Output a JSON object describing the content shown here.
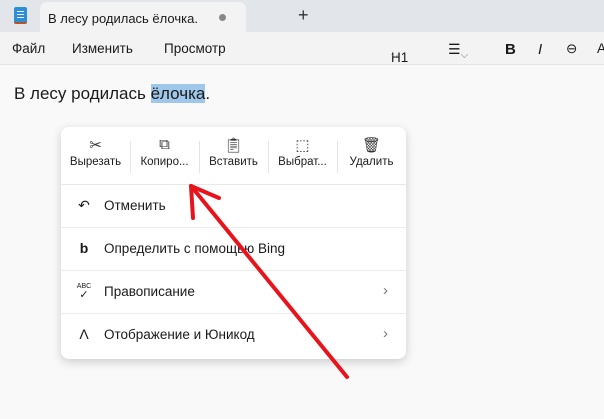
{
  "window": {
    "tab_title": "В лесу родилась ёлочка.",
    "new_tab": "+"
  },
  "menu": [
    "Файл",
    "Изменить",
    "Просмотр"
  ],
  "toolbar": {
    "heading": "H1",
    "bold": "B",
    "italic": "I"
  },
  "editor": {
    "text_before": "В лесу родилась ",
    "selected": "ёлочка",
    "text_after": "."
  },
  "context_menu": {
    "tools": [
      {
        "icon": "scissors-icon",
        "label": "Вырезать"
      },
      {
        "icon": "copy-icon",
        "label": "Копиро..."
      },
      {
        "icon": "paste-icon",
        "label": "Вставить"
      },
      {
        "icon": "select-all-icon",
        "label": "Выбрат..."
      },
      {
        "icon": "trash-icon",
        "label": "Удалить"
      }
    ],
    "items": [
      {
        "icon": "undo-icon",
        "label": "Отменить"
      },
      {
        "icon": "bing-icon",
        "label": "Определить с помощью Bing"
      },
      {
        "icon": "spelling-icon",
        "label": "Правописание",
        "abc": "ABC"
      },
      {
        "icon": "unicode-icon",
        "label": "Отображение и Юникод"
      }
    ]
  },
  "annotation": {
    "color": "#e8141c"
  }
}
